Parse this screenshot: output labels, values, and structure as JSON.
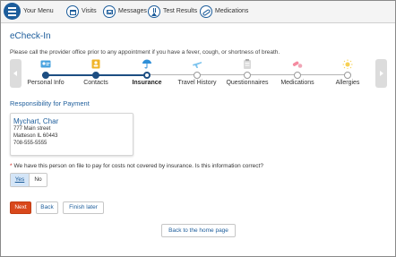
{
  "nav": {
    "menu_label": "Your Menu",
    "items": [
      {
        "label": "Visits",
        "icon": "calendar-icon"
      },
      {
        "label": "Messages",
        "icon": "envelope-icon"
      },
      {
        "label": "Test Results",
        "icon": "flask-icon"
      },
      {
        "label": "Medications",
        "icon": "pills-icon"
      }
    ]
  },
  "page": {
    "title": "eCheck-In",
    "notice": "Please call the provider office prior to any appointment if you have a fever, cough, or shortness of breath."
  },
  "steps": [
    {
      "label": "Personal Info",
      "status": "done",
      "icon": "id-card-icon"
    },
    {
      "label": "Contacts",
      "status": "done",
      "icon": "address-book-icon"
    },
    {
      "label": "Insurance",
      "status": "current",
      "icon": "umbrella-icon"
    },
    {
      "label": "Travel History",
      "status": "todo",
      "icon": "airplane-icon"
    },
    {
      "label": "Questionnaires",
      "status": "todo",
      "icon": "clipboard-icon"
    },
    {
      "label": "Medications",
      "status": "todo",
      "icon": "pills-icon"
    },
    {
      "label": "Allergies",
      "status": "todo",
      "icon": "sun-icon"
    }
  ],
  "responsibility": {
    "title": "Responsibility for Payment",
    "name": "Mychart, Char",
    "street": "777 Main street",
    "city": "Matteson IL 60443",
    "phone": "708-555-5555"
  },
  "question": {
    "required_mark": "*",
    "text": "We have this person on file to pay for costs not covered by insurance. Is this information correct?",
    "yes": "Yes",
    "no": "No"
  },
  "buttons": {
    "next": "Next",
    "back": "Back",
    "finish_later": "Finish later",
    "home": "Back to the home page"
  },
  "colors": {
    "accent": "#1d5d9b",
    "primary_button": "#d9481c",
    "progress": "#1d4e82"
  }
}
